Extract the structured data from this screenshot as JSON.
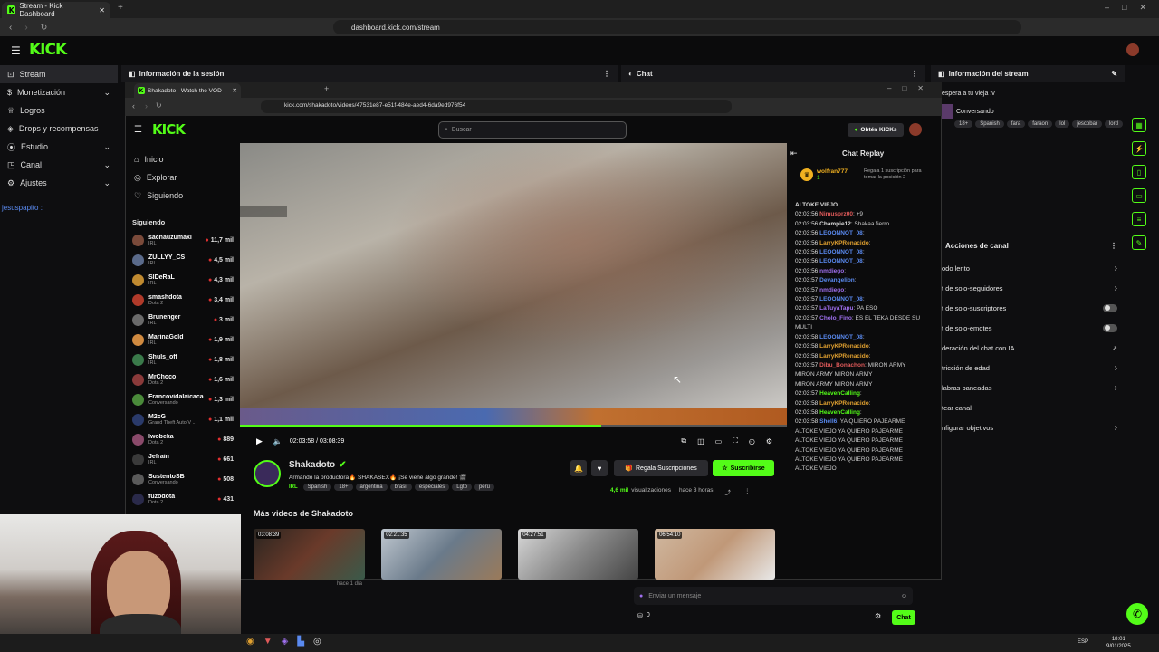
{
  "browser": {
    "tab_title": "Stream - Kick Dashboard",
    "url": "dashboard.kick.com/stream"
  },
  "dashboard": {
    "logo": "KICK",
    "nav": [
      {
        "label": "Stream",
        "icon": "stream-icon",
        "active": true
      },
      {
        "label": "Monetización",
        "icon": "money-icon"
      },
      {
        "label": "Logros",
        "icon": "trophy-icon"
      },
      {
        "label": "Drops y recompensas",
        "icon": "gift-icon"
      },
      {
        "label": "Estudio",
        "icon": "studio-icon"
      },
      {
        "label": "Canal",
        "icon": "channel-icon"
      },
      {
        "label": "Ajustes",
        "icon": "gear-icon"
      }
    ],
    "session_panel_title": "Información de la sesión",
    "chat_panel_title": "Chat",
    "stream_info_title": "Información del stream",
    "chat_user": "jesuspapito",
    "chat_input_placeholder": "Enviar un mensaje",
    "chat_count": "0",
    "chat_button": "Chat"
  },
  "stream_info": {
    "title": "espera a tu vieja :v",
    "category": "Conversando",
    "tags": [
      "18+",
      "Spanish",
      "fara",
      "faraon",
      "lol",
      "jescobar",
      "lord"
    ]
  },
  "channel_actions": {
    "title": "Acciones de canal",
    "items": [
      {
        "label": "odo lento",
        "control": "chevron"
      },
      {
        "label": "t de solo-seguidores",
        "control": "chevron"
      },
      {
        "label": "t de solo-suscriptores",
        "control": "toggle"
      },
      {
        "label": "t de solo-emotes",
        "control": "toggle"
      },
      {
        "label": "deración del chat con IA",
        "control": "link"
      },
      {
        "label": "tricción de edad",
        "control": "chevron"
      },
      {
        "label": "labras baneadas",
        "control": "chevron"
      },
      {
        "label": "tear canal",
        "control": "none"
      },
      {
        "label": "nfigurar objetivos",
        "control": "chevron"
      }
    ]
  },
  "vod_browser": {
    "tab_title": "Shakadoto - Watch the VOD",
    "url": "kick.com/shakadoto/videos/47531e87-e51f-484e-aed4-6da9ed976f54",
    "search_placeholder": "Buscar",
    "kicks_button": "Obtén KICKs",
    "nav": [
      {
        "label": "Inicio",
        "icon": "home-icon"
      },
      {
        "label": "Explorar",
        "icon": "compass-icon"
      },
      {
        "label": "Siguiendo",
        "icon": "heart-icon"
      }
    ],
    "following_title": "Siguiendo",
    "following": [
      {
        "name": "sachauzumaki",
        "sub": "IRL",
        "viewers": "11,7 mil"
      },
      {
        "name": "ZULLYY_CS",
        "sub": "IRL",
        "viewers": "4,5 mil"
      },
      {
        "name": "SlDeRaL",
        "sub": "IRL",
        "viewers": "4,3 mil"
      },
      {
        "name": "smashdota",
        "sub": "Dota 2",
        "viewers": "3,4 mil"
      },
      {
        "name": "Brunenger",
        "sub": "IRL",
        "viewers": "3 mil"
      },
      {
        "name": "MarinaGold",
        "sub": "IRL",
        "viewers": "1,9 mil"
      },
      {
        "name": "Shuls_off",
        "sub": "IRL",
        "viewers": "1,8 mil"
      },
      {
        "name": "MrChoco",
        "sub": "Dota 2",
        "viewers": "1,6 mil"
      },
      {
        "name": "Francovidalaicaca...",
        "sub": "Conversando",
        "viewers": "1,3 mil"
      },
      {
        "name": "M2cG",
        "sub": "Grand Theft Auto V ...",
        "viewers": "1,1 mil"
      },
      {
        "name": "lwobeka",
        "sub": "Dota 2",
        "viewers": "889"
      },
      {
        "name": "Jefrain",
        "sub": "IRL",
        "viewers": "661"
      },
      {
        "name": "SustentoSB",
        "sub": "Conversando",
        "viewers": "508"
      },
      {
        "name": "fuzodota",
        "sub": "Dota 2",
        "viewers": "431"
      }
    ],
    "player": {
      "time": "02:03:58 / 03:08:39",
      "progress": 0.66
    },
    "channel": {
      "name": "Shakadoto",
      "title": "Armando la productora🔥 SHAKASEX🔥 ¡Se viene algo grande! 🎬",
      "category": "IRL",
      "tags": [
        "Spanish",
        "18+",
        "argentina",
        "brasil",
        "especiales",
        "Lgtb",
        "perú"
      ],
      "views": "4,6 mil",
      "views_label": "visualizaciones",
      "ago": "hace 3 horas",
      "gift_button": "Regala Suscripciones",
      "subscribe_button": "Suscribirse"
    },
    "more_videos_title": "Más videos de Shakadoto",
    "videos": [
      {
        "duration": "03:08:39",
        "ago": "hace 1 día"
      },
      {
        "duration": "02:21:35"
      },
      {
        "duration": "04:27:51"
      },
      {
        "duration": "06:54:10"
      }
    ]
  },
  "chat_replay": {
    "title": "Chat Replay",
    "pinned_user": "wolfran777",
    "pinned_count": "1",
    "pinned_text": "Regala 1 suscripción para tomar la posición 2",
    "messages": [
      {
        "time": "",
        "user": "ALTOKE VIEJO",
        "text": "",
        "color": "#ddd"
      },
      {
        "time": "02:03:56",
        "user": "Nimusprz00",
        "text": ": +9",
        "color": "#e05a5a"
      },
      {
        "time": "02:03:56",
        "user": "Champie12",
        "text": ": Shakaa fierro",
        "color": "#ddd"
      },
      {
        "time": "02:03:56",
        "user": "LEOONNOT_08",
        "text": ":",
        "color": "#5a8af0"
      },
      {
        "time": "02:03:56",
        "user": "LarryKPRenacido",
        "text": ":",
        "color": "#e0a030"
      },
      {
        "time": "02:03:56",
        "user": "LEOONNOT_08",
        "text": ":",
        "color": "#5a8af0"
      },
      {
        "time": "02:03:56",
        "user": "LEOONNOT_08",
        "text": ":",
        "color": "#5a8af0"
      },
      {
        "time": "02:03:56",
        "user": "nmdiego",
        "text": ":",
        "color": "#a070f0"
      },
      {
        "time": "02:03:57",
        "user": "Devangelion",
        "text": ":",
        "color": "#5a8af0"
      },
      {
        "time": "02:03:57",
        "user": "nmdiego",
        "text": ":",
        "color": "#a070f0"
      },
      {
        "time": "02:03:57",
        "user": "LEOONNOT_08",
        "text": ":",
        "color": "#5a8af0"
      },
      {
        "time": "02:03:57",
        "user": "LaTuyaTapu",
        "text": ": PA ESO",
        "color": "#a070f0"
      },
      {
        "time": "02:03:57",
        "user": "Cholo_Fino",
        "text": ": ES EL TEKA DESDE SU",
        "color": "#a070f0"
      },
      {
        "time": "",
        "user": "",
        "text": "MULTI",
        "color": "#ddd"
      },
      {
        "time": "02:03:58",
        "user": "LEOONNOT_08",
        "text": ":",
        "color": "#5a8af0"
      },
      {
        "time": "02:03:58",
        "user": "LarryKPRenacido",
        "text": ":",
        "color": "#e0a030"
      },
      {
        "time": "02:03:58",
        "user": "LarryKPRenacido",
        "text": ":",
        "color": "#e0a030"
      },
      {
        "time": "02:03:57",
        "user": "Dibu_Bonachon",
        "text": ": MIRON ARMY",
        "color": "#e05a5a"
      },
      {
        "time": "",
        "user": "",
        "text": "MIRON ARMY  MIRON ARMY",
        "color": "#ddd"
      },
      {
        "time": "",
        "user": "",
        "text": "MIRON ARMY  MIRON ARMY",
        "color": "#ddd"
      },
      {
        "time": "02:03:57",
        "user": "HeavenCalling",
        "text": ":",
        "color": "#53fc18"
      },
      {
        "time": "02:03:58",
        "user": "LarryKPRenacido",
        "text": ":",
        "color": "#e0a030"
      },
      {
        "time": "02:03:58",
        "user": "HeavenCalling",
        "text": ":",
        "color": "#53fc18"
      },
      {
        "time": "02:03:58",
        "user": "Shell6",
        "text": ": YA QUIERO PAJEARME",
        "color": "#5a8af0"
      },
      {
        "time": "",
        "user": "",
        "text": "ALTOKE VIEJO  YA QUIERO PAJEARME",
        "color": "#ddd"
      },
      {
        "time": "",
        "user": "",
        "text": "ALTOKE VIEJO  YA QUIERO PAJEARME",
        "color": "#ddd"
      },
      {
        "time": "",
        "user": "",
        "text": "ALTOKE VIEJO  YA QUIERO PAJEARME",
        "color": "#ddd"
      },
      {
        "time": "",
        "user": "",
        "text": "ALTOKE VIEJO  YA QUIERO PAJEARME",
        "color": "#ddd"
      },
      {
        "time": "",
        "user": "",
        "text": "ALTOKE VIEJO",
        "color": "#ddd"
      }
    ]
  },
  "taskbar": {
    "lang": "ESP",
    "time": "18:01",
    "date": "9/01/2025"
  },
  "colors": {
    "brand": "#53fc18",
    "bg": "#0e0e10"
  }
}
